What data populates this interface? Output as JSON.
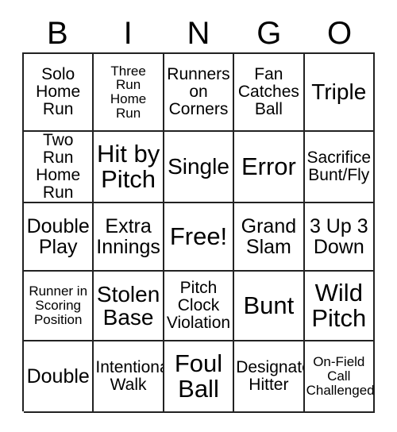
{
  "card": {
    "title": "BINGO",
    "columns": [
      "B",
      "I",
      "N",
      "G",
      "O"
    ],
    "free_space_label": "Free!",
    "border_color": "#222222",
    "text_color": "#000000",
    "background_color": "#ffffff",
    "rows": [
      [
        {
          "text": "Solo\nHome\nRun",
          "size": "md"
        },
        {
          "text": "Three\nRun\nHome\nRun",
          "size": "sm"
        },
        {
          "text": "Runners\non\nCorners",
          "size": "md"
        },
        {
          "text": "Fan\nCatches\nBall",
          "size": "md"
        },
        {
          "text": "Triple",
          "size": "xl"
        }
      ],
      [
        {
          "text": "Two Run\nHome\nRun",
          "size": "md"
        },
        {
          "text": "Hit by\nPitch",
          "size": "xxl"
        },
        {
          "text": "Single",
          "size": "xl"
        },
        {
          "text": "Error",
          "size": "xxl"
        },
        {
          "text": "Sacrifice\nBunt/Fly",
          "size": "md"
        }
      ],
      [
        {
          "text": "Double\nPlay",
          "size": "lg"
        },
        {
          "text": "Extra\nInnings",
          "size": "lg"
        },
        {
          "text": "Free!",
          "size": "xxl"
        },
        {
          "text": "Grand\nSlam",
          "size": "lg"
        },
        {
          "text": "3 Up 3\nDown",
          "size": "lg"
        }
      ],
      [
        {
          "text": "Runner in\nScoring\nPosition",
          "size": "sm"
        },
        {
          "text": "Stolen\nBase",
          "size": "xl"
        },
        {
          "text": "Pitch\nClock\nViolation",
          "size": "md"
        },
        {
          "text": "Bunt",
          "size": "xxl"
        },
        {
          "text": "Wild\nPitch",
          "size": "xxl"
        }
      ],
      [
        {
          "text": "Double",
          "size": "lg"
        },
        {
          "text": "Intentional\nWalk",
          "size": "md"
        },
        {
          "text": "Foul\nBall",
          "size": "xxl"
        },
        {
          "text": "Designated\nHitter",
          "size": "md"
        },
        {
          "text": "On-Field\nCall\nChallenged",
          "size": "sm"
        }
      ]
    ]
  }
}
